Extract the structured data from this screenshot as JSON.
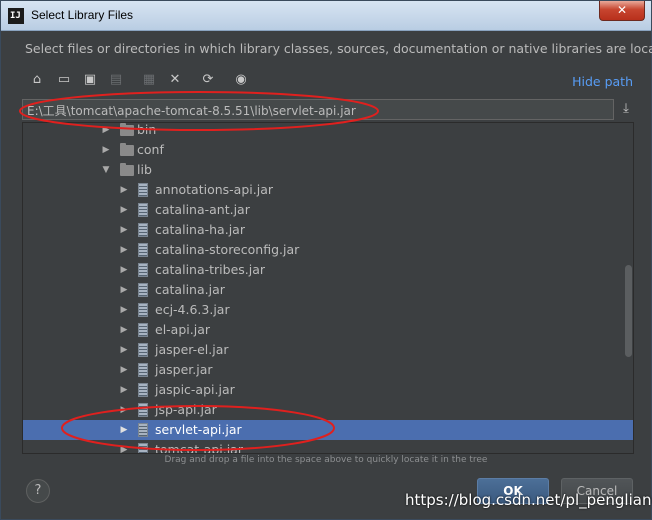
{
  "window": {
    "app_icon_text": "IJ",
    "title": "Select Library Files",
    "close_label": "✕"
  },
  "description": "Select files or directories in which library classes, sources, documentation or native libraries are located",
  "toolbar": {
    "buttons": [
      {
        "name": "home-icon",
        "glyph": "⌂",
        "enabled": true
      },
      {
        "name": "desktop-icon",
        "glyph": "▭",
        "enabled": true
      },
      {
        "name": "project-folder-icon",
        "glyph": "▣",
        "enabled": true
      },
      {
        "name": "module-folder-icon",
        "glyph": "▤",
        "enabled": false
      },
      {
        "name": "new-folder-icon",
        "glyph": "▦",
        "enabled": false
      },
      {
        "name": "delete-icon",
        "glyph": "✕",
        "enabled": true
      },
      {
        "name": "refresh-icon",
        "glyph": "⟳",
        "enabled": true
      },
      {
        "name": "show-hidden-icon",
        "glyph": "◉",
        "enabled": true
      }
    ],
    "hide_path_label": "Hide path"
  },
  "path": {
    "value": "E:\\工具\\tomcat\\apache-tomcat-8.5.51\\lib\\servlet-api.jar"
  },
  "tree": {
    "items": [
      {
        "label": "bin",
        "type": "folder",
        "level": 1,
        "expanded": false,
        "selected": false
      },
      {
        "label": "conf",
        "type": "folder",
        "level": 1,
        "expanded": false,
        "selected": false
      },
      {
        "label": "lib",
        "type": "folder",
        "level": 1,
        "expanded": true,
        "selected": false
      },
      {
        "label": "annotations-api.jar",
        "type": "jar",
        "level": 2,
        "expanded": false,
        "selected": false
      },
      {
        "label": "catalina-ant.jar",
        "type": "jar",
        "level": 2,
        "expanded": false,
        "selected": false
      },
      {
        "label": "catalina-ha.jar",
        "type": "jar",
        "level": 2,
        "expanded": false,
        "selected": false
      },
      {
        "label": "catalina-storeconfig.jar",
        "type": "jar",
        "level": 2,
        "expanded": false,
        "selected": false
      },
      {
        "label": "catalina-tribes.jar",
        "type": "jar",
        "level": 2,
        "expanded": false,
        "selected": false
      },
      {
        "label": "catalina.jar",
        "type": "jar",
        "level": 2,
        "expanded": false,
        "selected": false
      },
      {
        "label": "ecj-4.6.3.jar",
        "type": "jar",
        "level": 2,
        "expanded": false,
        "selected": false
      },
      {
        "label": "el-api.jar",
        "type": "jar",
        "level": 2,
        "expanded": false,
        "selected": false
      },
      {
        "label": "jasper-el.jar",
        "type": "jar",
        "level": 2,
        "expanded": false,
        "selected": false
      },
      {
        "label": "jasper.jar",
        "type": "jar",
        "level": 2,
        "expanded": false,
        "selected": false
      },
      {
        "label": "jaspic-api.jar",
        "type": "jar",
        "level": 2,
        "expanded": false,
        "selected": false
      },
      {
        "label": "jsp-api.jar",
        "type": "jar",
        "level": 2,
        "expanded": false,
        "selected": false
      },
      {
        "label": "servlet-api.jar",
        "type": "jar",
        "level": 2,
        "expanded": false,
        "selected": true
      },
      {
        "label": "tomcat-api.jar",
        "type": "jar",
        "level": 2,
        "expanded": false,
        "selected": false
      }
    ]
  },
  "hint": "Drag and drop a file into the space above to quickly locate it in the tree",
  "buttons": {
    "help": "?",
    "ok": "OK",
    "cancel": "Cancel"
  },
  "watermark": "https://blog.csdn.net/pl_pengliang",
  "colors": {
    "selection": "#4b6eaf",
    "annotation": "#e0201e",
    "link": "#589df6"
  }
}
